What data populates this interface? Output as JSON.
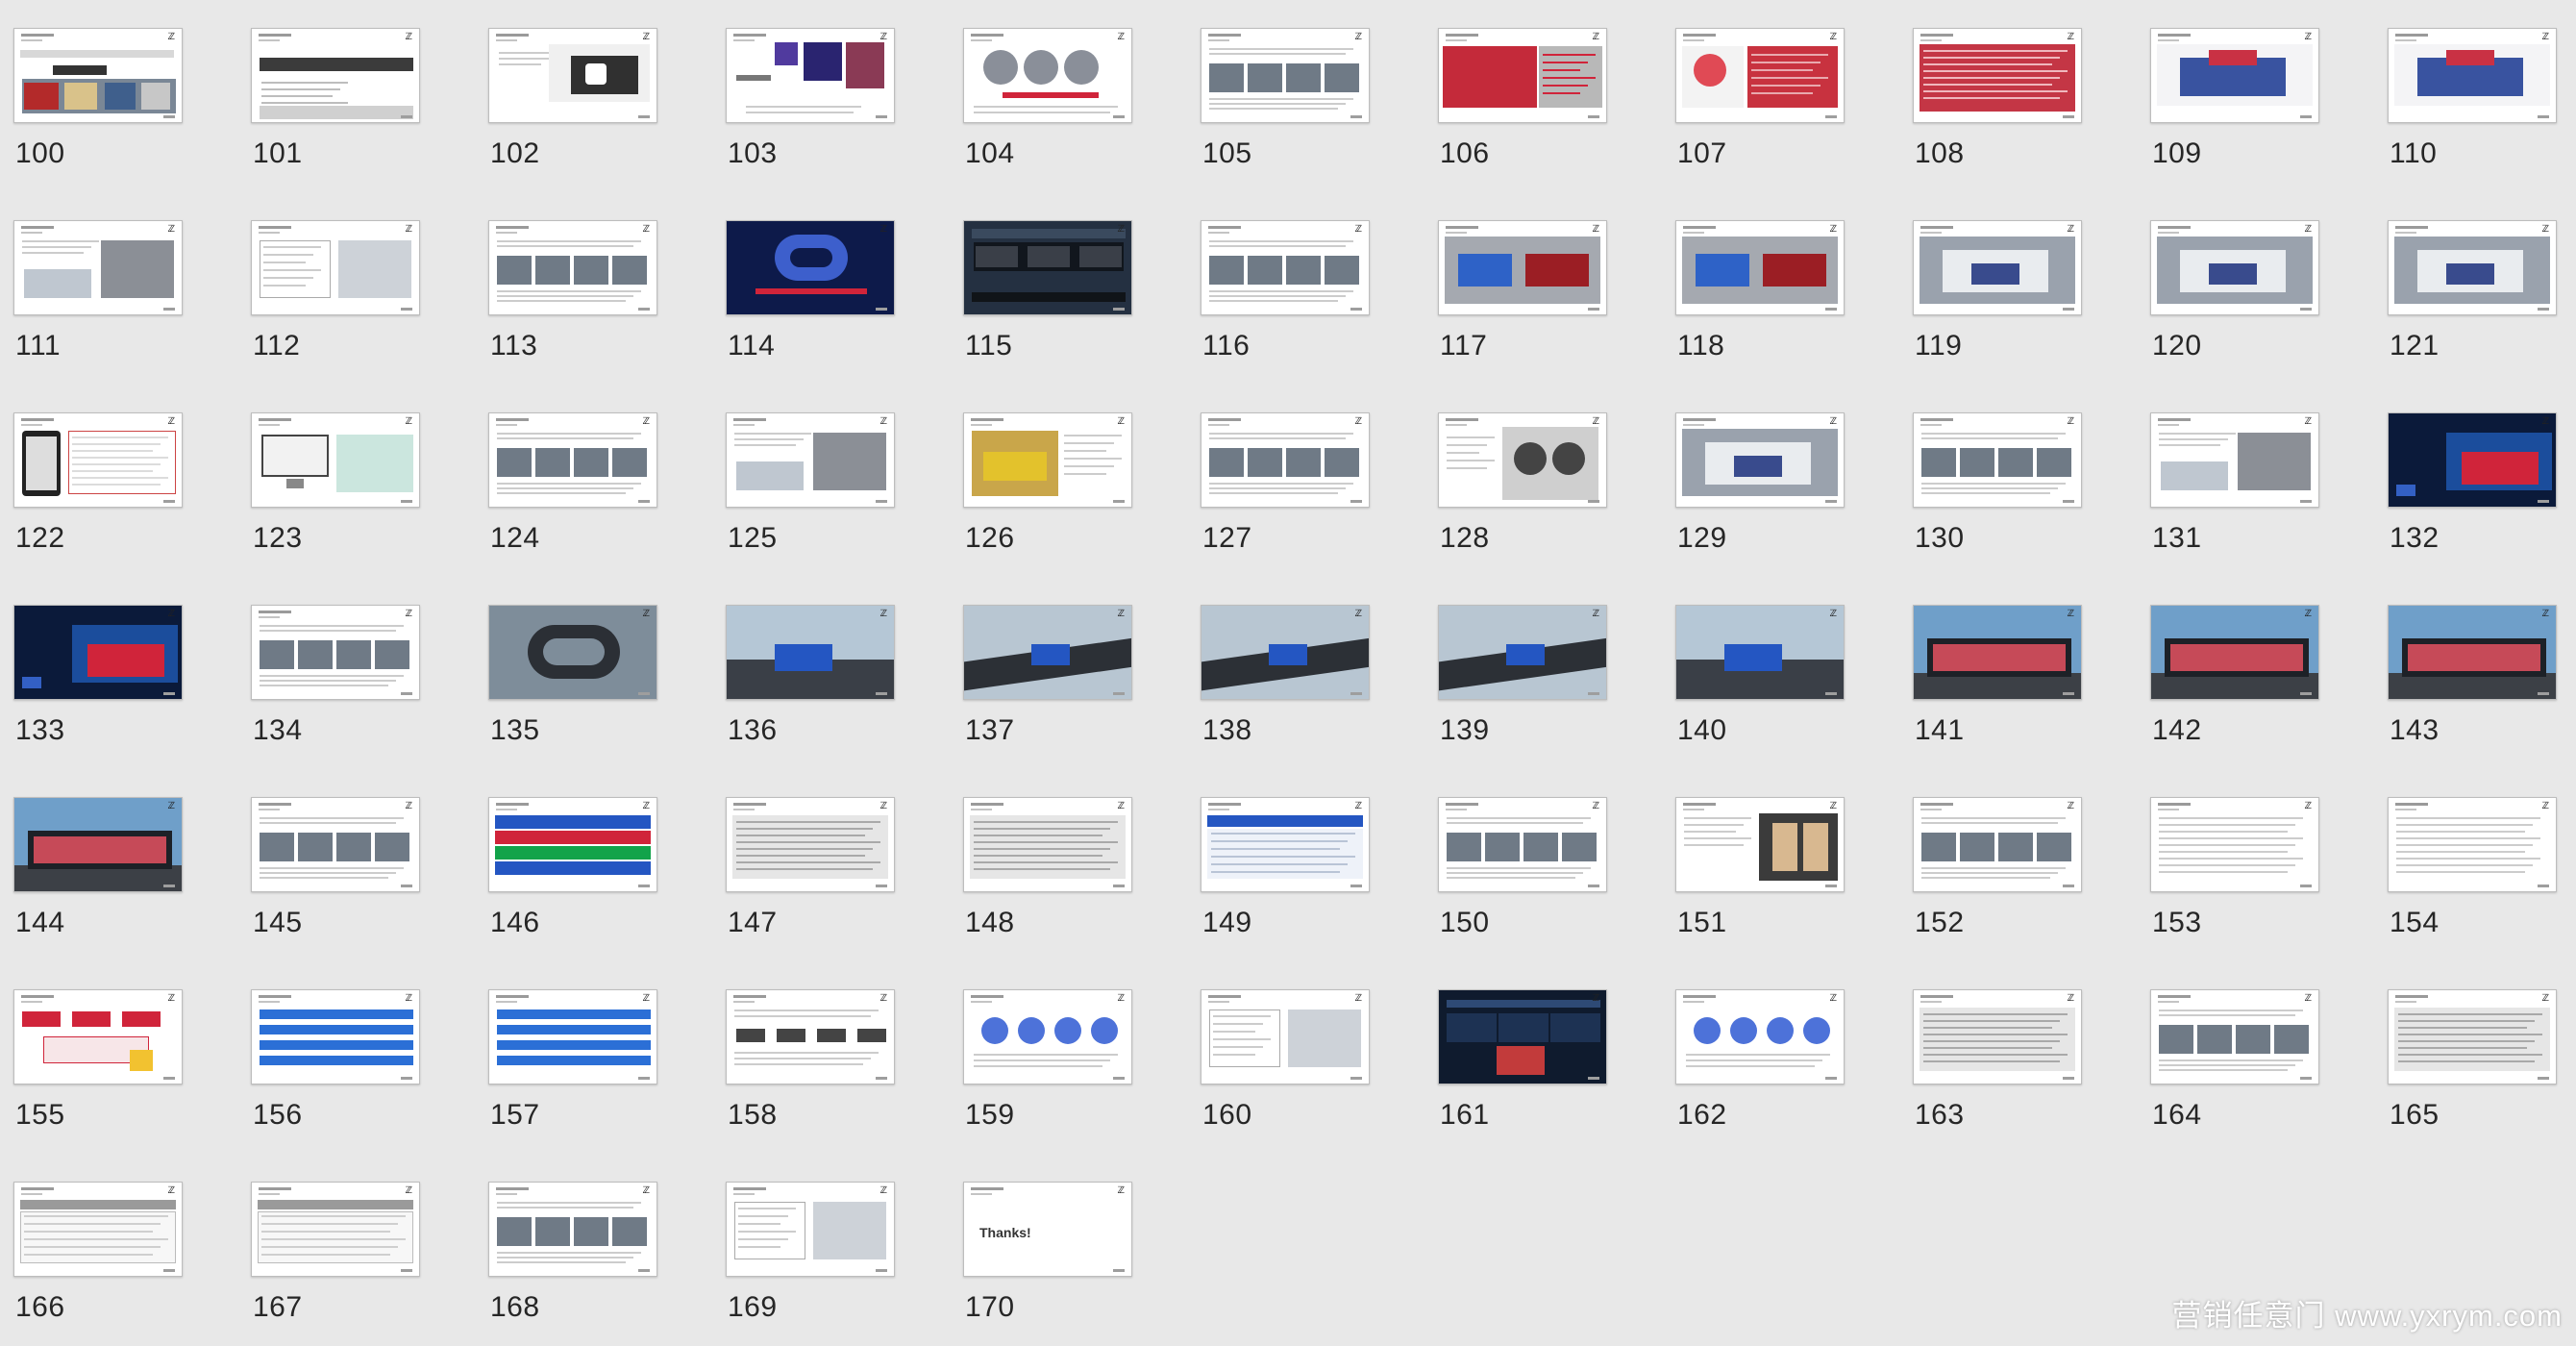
{
  "slides": [
    {
      "number": "100",
      "style": "title-cars"
    },
    {
      "number": "101",
      "style": "title-bar"
    },
    {
      "number": "102",
      "style": "puzzle"
    },
    {
      "number": "103",
      "style": "brand"
    },
    {
      "number": "104",
      "style": "circles"
    },
    {
      "number": "105",
      "style": "photos"
    },
    {
      "number": "106",
      "style": "red-people"
    },
    {
      "number": "107",
      "style": "red-chart"
    },
    {
      "number": "108",
      "style": "red-table"
    },
    {
      "number": "109",
      "style": "booth"
    },
    {
      "number": "110",
      "style": "booth"
    },
    {
      "number": "111",
      "style": "text-photo"
    },
    {
      "number": "112",
      "style": "text-box"
    },
    {
      "number": "113",
      "style": "photos"
    },
    {
      "number": "114",
      "style": "blue-cloud"
    },
    {
      "number": "115",
      "style": "dark-panel"
    },
    {
      "number": "116",
      "style": "photos"
    },
    {
      "number": "117",
      "style": "cars"
    },
    {
      "number": "118",
      "style": "cars"
    },
    {
      "number": "119",
      "style": "showroom"
    },
    {
      "number": "120",
      "style": "showroom"
    },
    {
      "number": "121",
      "style": "showroom"
    },
    {
      "number": "122",
      "style": "phone-table"
    },
    {
      "number": "123",
      "style": "screen"
    },
    {
      "number": "124",
      "style": "photos"
    },
    {
      "number": "125",
      "style": "text-photo"
    },
    {
      "number": "126",
      "style": "car-yellow"
    },
    {
      "number": "127",
      "style": "photos"
    },
    {
      "number": "128",
      "style": "binoculars"
    },
    {
      "number": "129",
      "style": "showroom"
    },
    {
      "number": "130",
      "style": "photos"
    },
    {
      "number": "131",
      "style": "text-photo"
    },
    {
      "number": "132",
      "style": "car-poster"
    },
    {
      "number": "133",
      "style": "car-poster"
    },
    {
      "number": "134",
      "style": "photos"
    },
    {
      "number": "135",
      "style": "render-track"
    },
    {
      "number": "136",
      "style": "render-car"
    },
    {
      "number": "137",
      "style": "render-road"
    },
    {
      "number": "138",
      "style": "render-road"
    },
    {
      "number": "139",
      "style": "render-road"
    },
    {
      "number": "140",
      "style": "render-car"
    },
    {
      "number": "141",
      "style": "building"
    },
    {
      "number": "142",
      "style": "building"
    },
    {
      "number": "143",
      "style": "building"
    },
    {
      "number": "144",
      "style": "building"
    },
    {
      "number": "145",
      "style": "photos"
    },
    {
      "number": "146",
      "style": "table-color"
    },
    {
      "number": "147",
      "style": "table-grey"
    },
    {
      "number": "148",
      "style": "table-grey"
    },
    {
      "number": "149",
      "style": "table-blue"
    },
    {
      "number": "150",
      "style": "photos"
    },
    {
      "number": "151",
      "style": "people"
    },
    {
      "number": "152",
      "style": "photos"
    },
    {
      "number": "153",
      "style": "text-list"
    },
    {
      "number": "154",
      "style": "text-list"
    },
    {
      "number": "155",
      "style": "flow-red"
    },
    {
      "number": "156",
      "style": "flow-blue"
    },
    {
      "number": "157",
      "style": "flow-blue"
    },
    {
      "number": "158",
      "style": "flow-grey"
    },
    {
      "number": "159",
      "style": "circles-blue"
    },
    {
      "number": "160",
      "style": "text-box"
    },
    {
      "number": "161",
      "style": "dark-dash"
    },
    {
      "number": "162",
      "style": "circles-blue"
    },
    {
      "number": "163",
      "style": "table-grey"
    },
    {
      "number": "164",
      "style": "photos"
    },
    {
      "number": "165",
      "style": "table-grey"
    },
    {
      "number": "166",
      "style": "table-plain"
    },
    {
      "number": "167",
      "style": "table-plain"
    },
    {
      "number": "168",
      "style": "photos"
    },
    {
      "number": "169",
      "style": "text-box"
    },
    {
      "number": "170",
      "style": "thanks",
      "text": "Thanks!"
    }
  ],
  "watermark": "营销任意门 www.yxrym.com",
  "colors": {
    "background": "#e8e8e8",
    "accent_red": "#d0243a",
    "accent_blue": "#2b6fd6",
    "dark": "#1d2430"
  }
}
